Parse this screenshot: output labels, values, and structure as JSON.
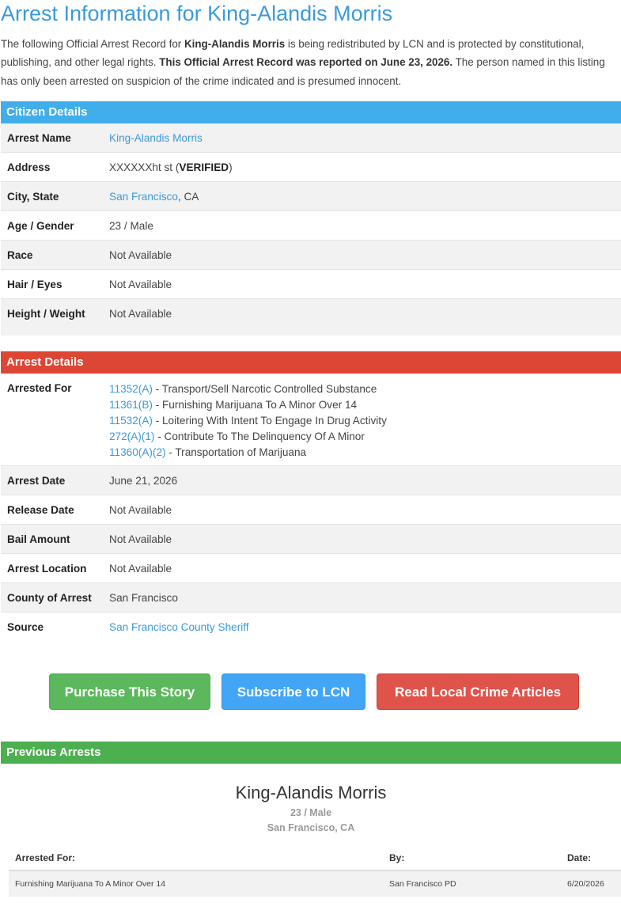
{
  "title": "Arrest Information for King-Alandis Morris",
  "intro": {
    "p1": "The following Official Arrest Record for ",
    "name": "King-Alandis Morris",
    "p2": " is being redistributed by LCN and is protected by constitutional, publishing, and other legal rights. ",
    "reported": "This Official Arrest Record was reported on June 23, 2026.",
    "p3": " The person named in this listing has only been arrested on suspicion of the crime indicated and is presumed innocent."
  },
  "citizen": {
    "heading": "Citizen Details",
    "arrest_name_label": "Arrest Name",
    "arrest_name": "King-Alandis Morris",
    "address_label": "Address",
    "address_text": "XXXXXXht st (",
    "address_verified": "VERIFIED",
    "address_close": ")",
    "city_label": "City, State",
    "city": "San Francisco",
    "state": ", CA",
    "age_label": "Age / Gender",
    "age": "23 / Male",
    "race_label": "Race",
    "race": "Not Available",
    "hair_label": "Hair / Eyes",
    "hair": "Not Available",
    "height_label": "Height / Weight",
    "height": "Not Available"
  },
  "arrest": {
    "heading": "Arrest Details",
    "arrested_for_label": "Arrested For",
    "charges": [
      {
        "code": "11352(A)",
        "desc": " - Transport/Sell Narcotic Controlled Substance"
      },
      {
        "code": "11361(B)",
        "desc": " - Furnishing Marijuana To A Minor Over 14"
      },
      {
        "code": "11532(A)",
        "desc": " - Loitering With Intent To Engage In Drug Activity"
      },
      {
        "code": "272(A)(1)",
        "desc": " - Contribute To The Delinquency Of A Minor"
      },
      {
        "code": "11360(A)(2)",
        "desc": " - Transportation of Marijuana"
      }
    ],
    "arrest_date_label": "Arrest Date",
    "arrest_date": "June 21, 2026",
    "release_label": "Release Date",
    "release": "Not Available",
    "bail_label": "Bail Amount",
    "bail": "Not Available",
    "location_label": "Arrest Location",
    "location": "Not Available",
    "county_label": "County of Arrest",
    "county": "San Francisco",
    "source_label": "Source",
    "source": "San Francisco County Sheriff"
  },
  "buttons": {
    "purchase": "Purchase This Story",
    "subscribe": "Subscribe to LCN",
    "read": "Read Local Crime Articles"
  },
  "previous": {
    "heading": "Previous Arrests",
    "name": "King-Alandis Morris",
    "age_gender": "23 / Male",
    "location": "San Francisco, CA",
    "col_for": "Arrested For:",
    "col_by": "By:",
    "col_date": "Date:",
    "rows": [
      {
        "for": "Furnishing Marijuana To A Minor Over 14",
        "by": "San Francisco PD",
        "date": "6/20/2026"
      }
    ]
  }
}
